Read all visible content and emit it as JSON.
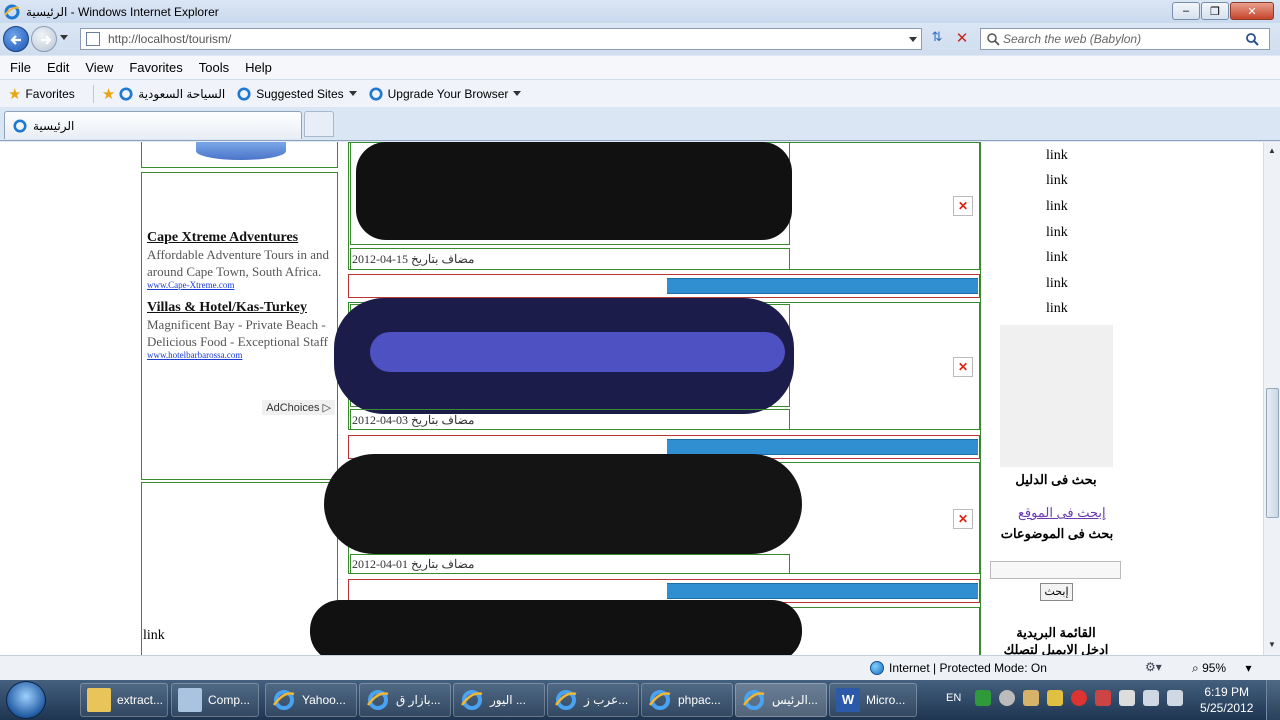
{
  "window": {
    "title": "الرئيسية - Windows Internet Explorer"
  },
  "address": {
    "url": "http://localhost/tourism/"
  },
  "search": {
    "placeholder": "Search the web (Babylon)"
  },
  "menu": [
    "File",
    "Edit",
    "View",
    "Favorites",
    "Tools",
    "Help"
  ],
  "favorites_bar": {
    "favorites_label": "Favorites",
    "items": [
      "السياحة السعودية",
      "Suggested Sites",
      "Upgrade Your Browser"
    ]
  },
  "tab": {
    "label": "الرئيسية"
  },
  "page": {
    "ads": [
      {
        "title": "Cape Xtreme Adventures",
        "desc": "Affordable Adventure Tours in and around Cape Town, South Africa.",
        "url": "www.Cape-Xtreme.com"
      },
      {
        "title": "Villas & Hotel/Kas-Turkey",
        "desc": "Magnificent Bay - Private Beach - Delicious Food - Exceptional Staff",
        "url": "www.hotelbarbarossa.com"
      }
    ],
    "adchoices": "AdChoices ▷",
    "left_link": "link",
    "posts": [
      {
        "date": "2012-04-15 مضاف بتاريخ"
      },
      {
        "date": "2012-04-03 مضاف بتاريخ"
      },
      {
        "date": "2012-04-01 مضاف بتاريخ"
      }
    ],
    "right_links": [
      "link",
      "link",
      "link",
      "link",
      "link",
      "link",
      "link"
    ],
    "search_directory": "بحث فى الدليل",
    "search_site": "إبحث فى الموقع",
    "search_topics": "بحث فى الموضوعات",
    "search_button": "إبحث",
    "mailing_list": "القائمة البريدية",
    "mailing_hint": "ادخل الايميل لتصلك اخر"
  },
  "status": {
    "zone": "Internet | Protected Mode: On",
    "zoom": "95%"
  },
  "taskbar": {
    "items": [
      {
        "label": "extract...",
        "icon": "folder-icon"
      },
      {
        "label": "Comp...",
        "icon": "computer-icon"
      },
      {
        "label": "Yahoo...",
        "icon": "ie-icon"
      },
      {
        "label": "بازار ق...",
        "icon": "ie-icon"
      },
      {
        "label": "اليور ...",
        "icon": "ie-icon"
      },
      {
        "label": "عرب ز...",
        "icon": "ie-icon"
      },
      {
        "label": "phpac...",
        "icon": "ie-icon"
      },
      {
        "label": "الرئيس...",
        "icon": "ie-icon"
      },
      {
        "label": "Micro...",
        "icon": "word-icon"
      }
    ],
    "language": "EN",
    "time": "6:19 PM",
    "date": "5/25/2012"
  },
  "colors": {
    "accent_blue": "#2f8fd0",
    "border_green": "#3a8a2e"
  }
}
